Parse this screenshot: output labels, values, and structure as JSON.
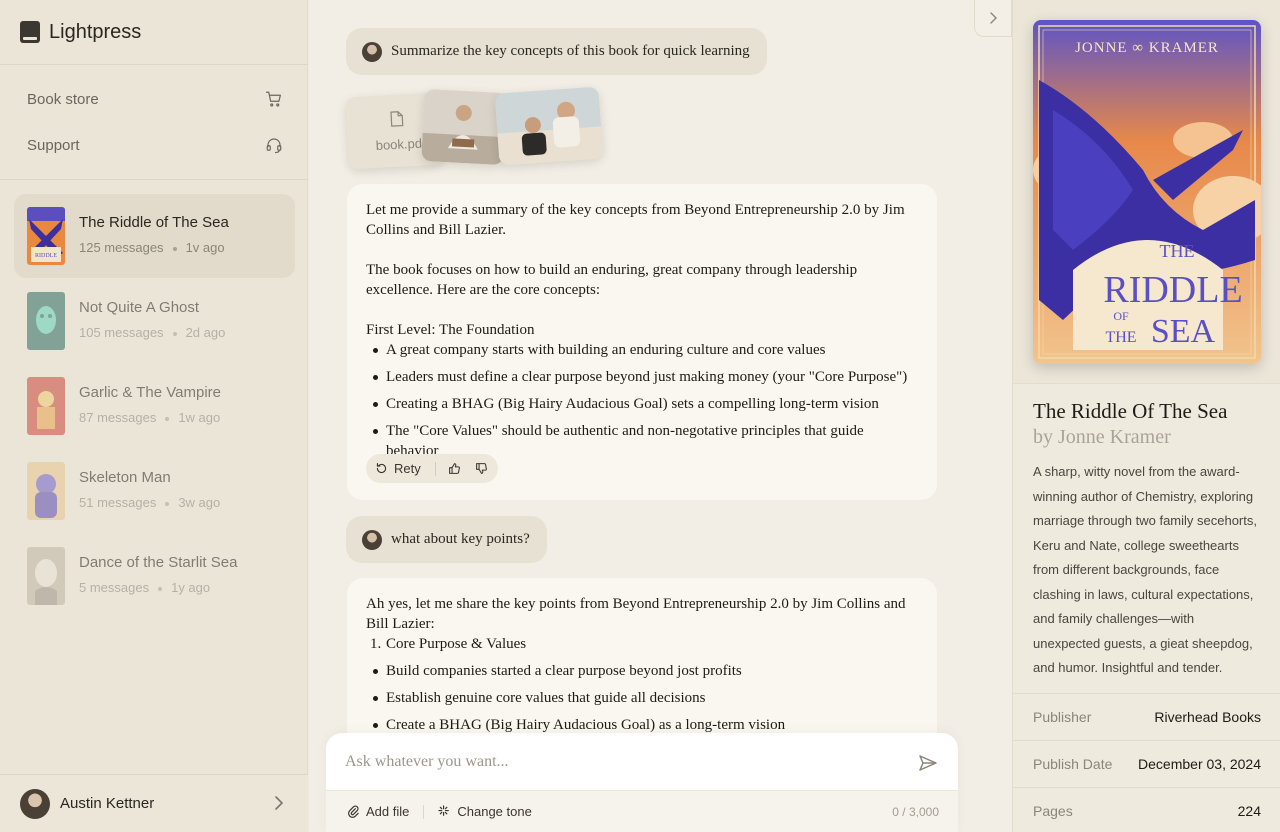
{
  "app": {
    "name": "Lightpress"
  },
  "sidebar": {
    "nav": [
      {
        "label": "Book store",
        "icon": "cart-icon"
      },
      {
        "label": "Support",
        "icon": "headset-icon"
      }
    ],
    "books": [
      {
        "title": "The Riddle of The Sea",
        "messages": "125 messages",
        "time": "1v ago",
        "active": true
      },
      {
        "title": "Not Quite A Ghost",
        "messages": "105 messages",
        "time": "2d ago"
      },
      {
        "title": "Garlic & The Vampire",
        "messages": "87 messages",
        "time": "1w ago"
      },
      {
        "title": "Skeleton Man",
        "messages": "51 messages",
        "time": "3w ago"
      },
      {
        "title": "Dance of the Starlit Sea",
        "messages": "5 messages",
        "time": "1y ago"
      }
    ],
    "user": {
      "name": "Austin Kettner"
    }
  },
  "chat": {
    "msg1": "Summarize the key concepts of this book for quick learning",
    "attachment": {
      "filename": "book.pd"
    },
    "reply1": {
      "intro": "Let me provide a summary of the key concepts from Beyond Entrepreneurship 2.0 by Jim Collins and Bill Lazier.",
      "para": "The book focuses on how to build an enduring, great company through leadership excellence. Here are the core concepts:",
      "heading": "First Level: The Foundation",
      "bullets": [
        "A great company starts with building an enduring culture and core values",
        "Leaders must define a clear purpose beyond just making money (your \"Core Purpose\")",
        "Creating a BHAG (Big Hairy Audacious Goal) sets a compelling long-term vision",
        "The \"Core Values\" should be authentic and non-negotative principles that guide behavior"
      ],
      "retry": "Rety"
    },
    "msg2": "what about key points?",
    "reply2": {
      "intro": "Ah yes, let me share the key points from Beyond Entrepreneurship 2.0 by Jim Collins and Bill Lazier:",
      "numbered": {
        "num": "1.",
        "text": "Core Purpose & Values"
      },
      "bullets": [
        "Build companies started a clear purpose beyond jost profits",
        "Establish genuine core values that guide all decisions",
        "Create a BHAG (Big Hairy Audacious Goal) as a long-term vision"
      ]
    },
    "input": {
      "placeholder": "Ask whatever you want...",
      "add_file": "Add file",
      "change_tone": "Change tone",
      "counter": "0 / 3,000"
    }
  },
  "detail": {
    "cover": {
      "author_line": "JONNE ∞ KRAMER",
      "title_lines": [
        "THE",
        "RIDDLE",
        "OF",
        "THE",
        "SEA"
      ]
    },
    "title": "The Riddle Of The Sea",
    "author": "by Jonne Kramer",
    "description": "A sharp, witty novel from the award-winning author of Chemistry, exploring marriage through two family secehorts, Keru and Nate, college sweethearts from different backgrounds, face clashing in laws, cultural expectations, and family challenges—with unexpected guests, a gieat sheepdog, and humor. Insightful and tender.",
    "meta": [
      {
        "label": "Publisher",
        "value": "Riverhead Books"
      },
      {
        "label": "Publish Date",
        "value": "December 03, 2024"
      },
      {
        "label": "Pages",
        "value": "224"
      }
    ]
  },
  "colors": {
    "background": "#efeade",
    "sidebar": "#ebe5d8",
    "bubble": "#e7e1d3",
    "card": "#faf7f0",
    "accent_blue": "#4a3fa8",
    "accent_orange": "#e8893f"
  }
}
